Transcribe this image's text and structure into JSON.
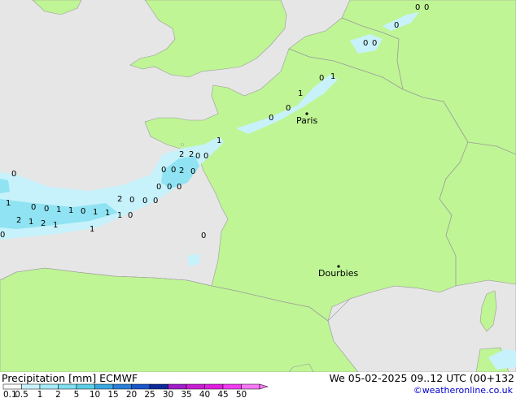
{
  "map": {
    "colors": {
      "land": "#bff595",
      "sea": "#e6e6e6",
      "border": "#9a9a9a",
      "precip_light": "#c7f2fb",
      "precip_mid": "#8fe3f2"
    },
    "cities": [
      {
        "name": "Paris"
      },
      {
        "name": "Dourbies"
      }
    ],
    "precip_values": [
      "0",
      "0",
      "0",
      "0",
      "0",
      "1",
      "0",
      "1",
      "0",
      "0",
      "1",
      "2",
      "2",
      "0",
      "0",
      "0",
      "0",
      "2",
      "0",
      "0",
      "0",
      "0",
      "0",
      "1",
      "0",
      "0",
      "1",
      "1",
      "0",
      "1",
      "1",
      "2",
      "1",
      "2",
      "2",
      "1",
      "1",
      "1",
      "0",
      "0",
      "0",
      "0",
      "0",
      "0"
    ]
  },
  "footer": {
    "title": "Precipitation [mm] ECMWF",
    "datetime": "We 05-02-2025 09..12 UTC (00+132",
    "credit": "©weatheronline.co.uk"
  },
  "legend": {
    "labels": [
      "0.1",
      "0.5",
      "1",
      "2",
      "5",
      "10",
      "15",
      "20",
      "25",
      "30",
      "35",
      "40",
      "45",
      "50"
    ],
    "colors": [
      "#fdfdfd",
      "#c7f2fb",
      "#a5ebf7",
      "#7fdeef",
      "#5ccde6",
      "#3aa8e0",
      "#2a7fd8",
      "#1b56c9",
      "#0d2a99",
      "#a01ec8",
      "#c81ed2",
      "#e01ee0",
      "#f03cf0",
      "#f878f8"
    ]
  }
}
